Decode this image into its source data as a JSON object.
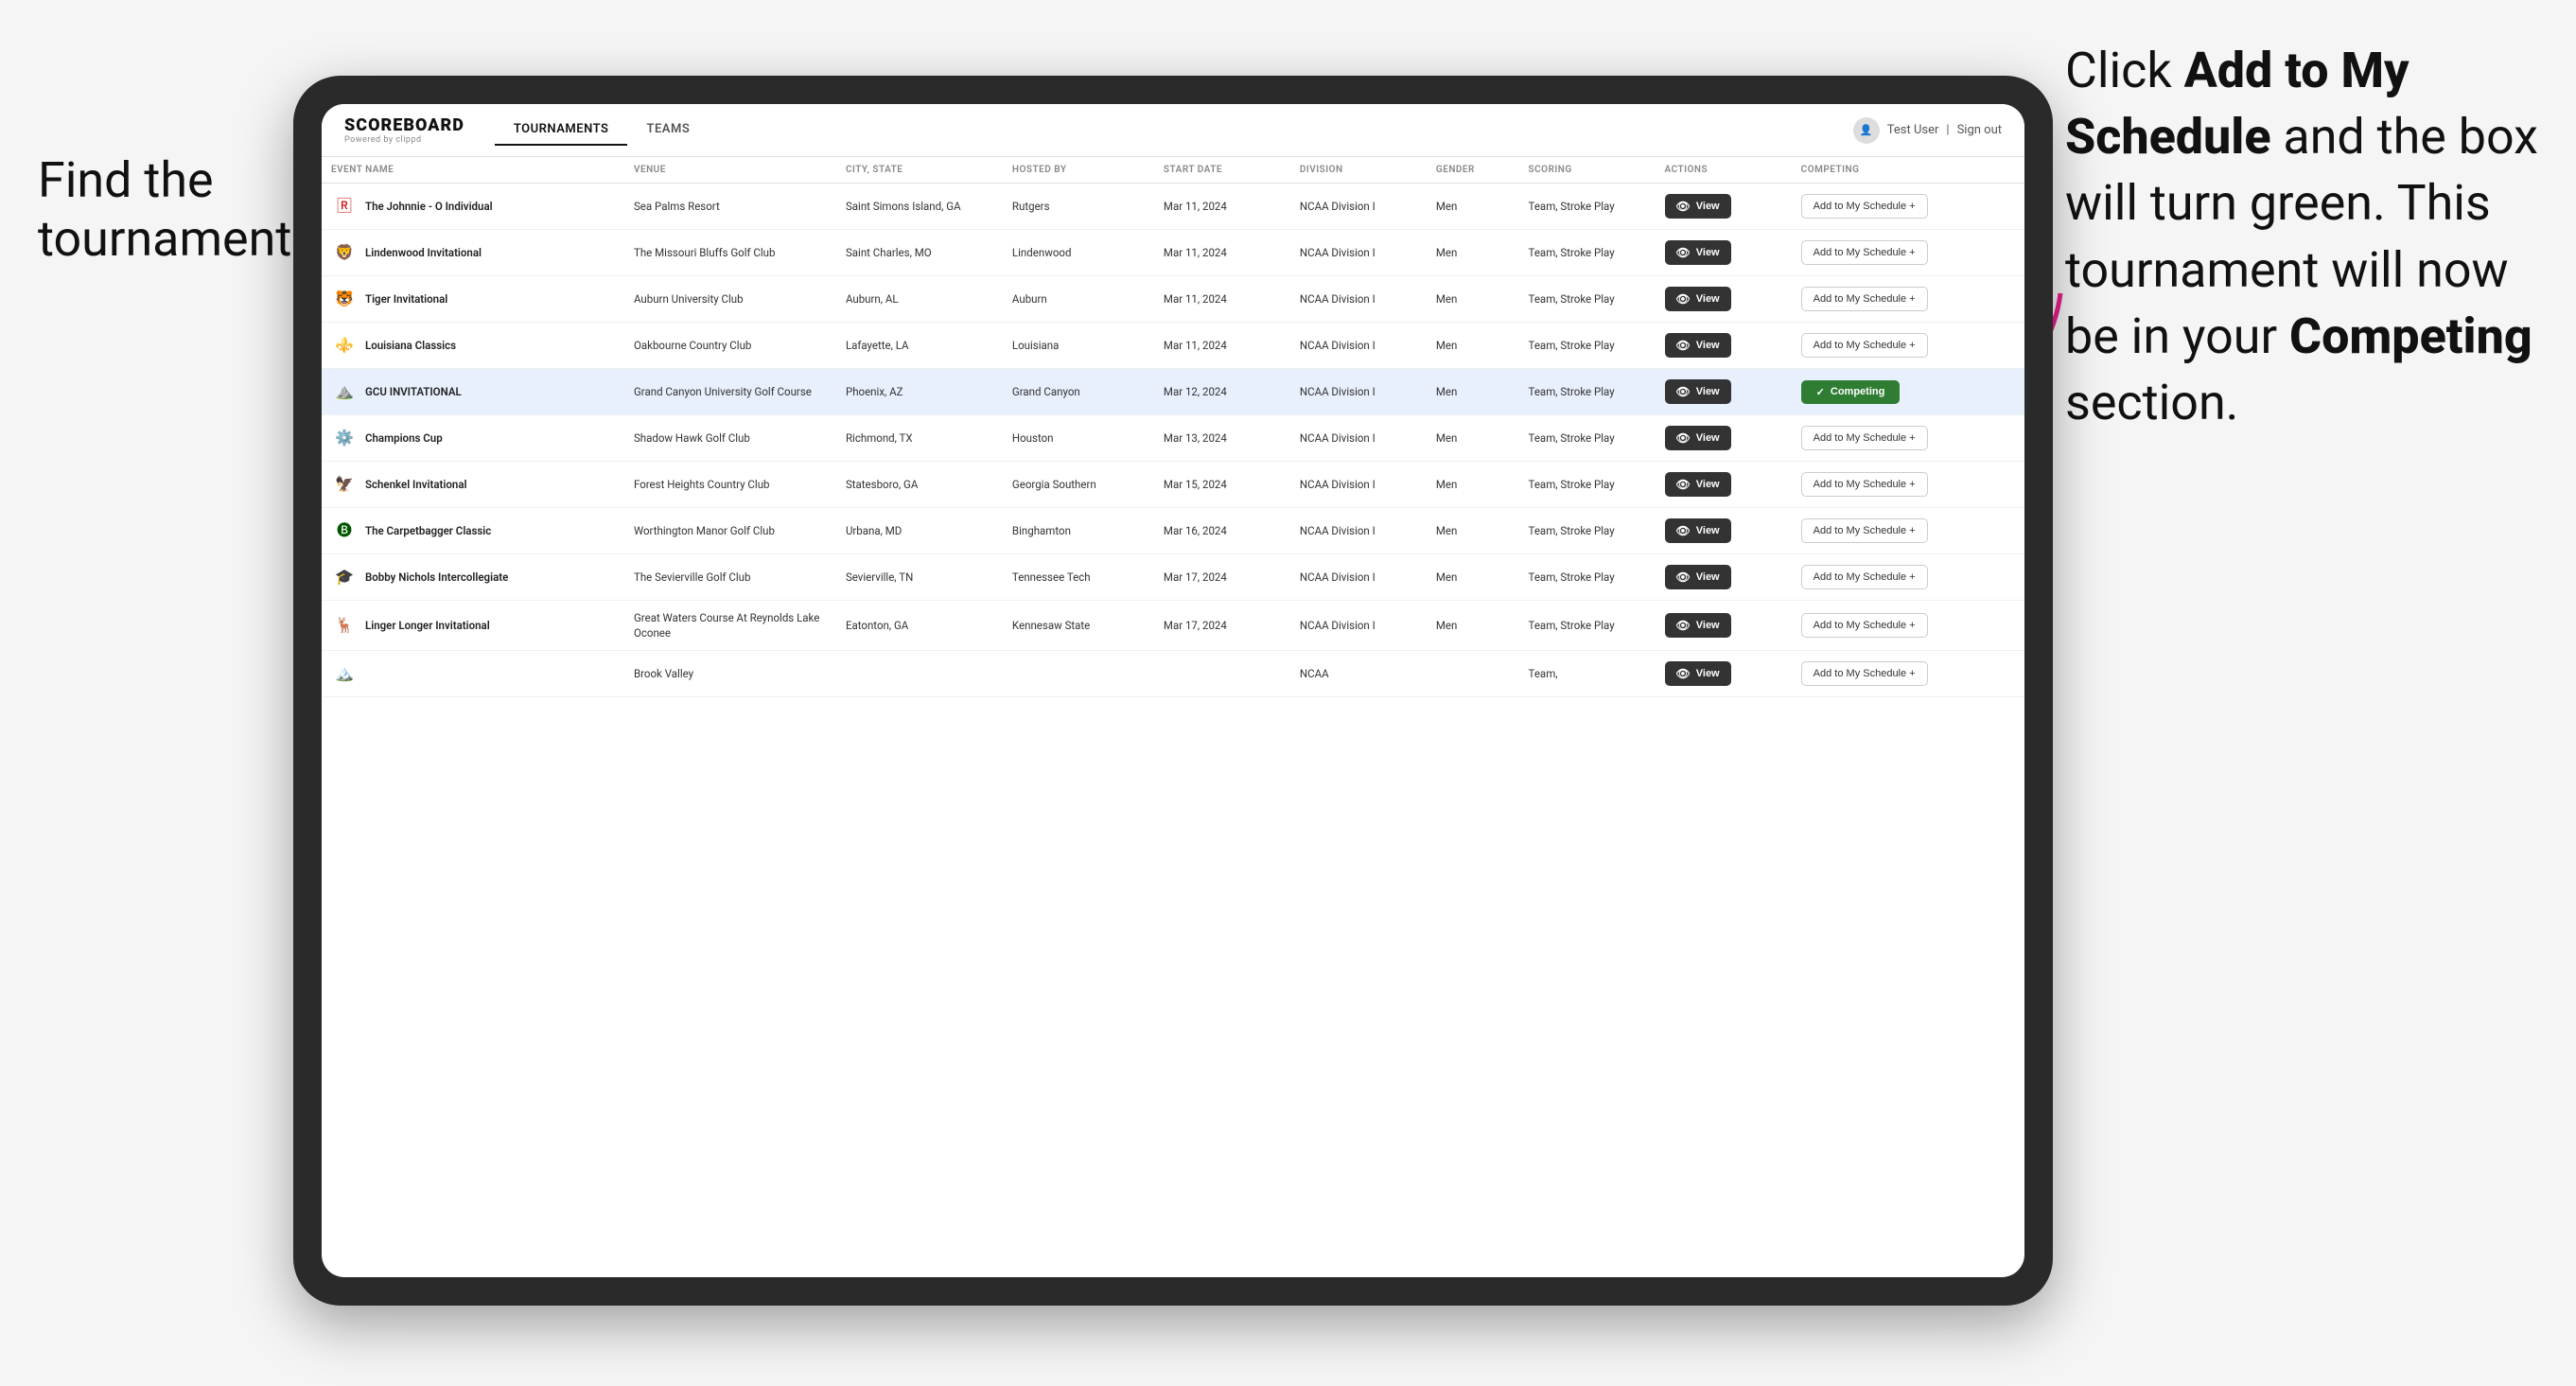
{
  "instructions": {
    "left": "Find the\ntournament.",
    "right_part1": "Click ",
    "right_bold1": "Add to My Schedule",
    "right_part2": " and the box will turn green. This tournament will now be in your ",
    "right_bold2": "Competing",
    "right_part3": " section."
  },
  "header": {
    "logo": "SCOREBOARD",
    "logo_sub": "Powered by clippd",
    "nav": [
      "TOURNAMENTS",
      "TEAMS"
    ],
    "active_nav": 0,
    "user": "Test User",
    "signout": "Sign out"
  },
  "table": {
    "columns": [
      "EVENT NAME",
      "VENUE",
      "CITY, STATE",
      "HOSTED BY",
      "START DATE",
      "DIVISION",
      "GENDER",
      "SCORING",
      "ACTIONS",
      "COMPETING"
    ],
    "rows": [
      {
        "logo": "🅁",
        "logo_color": "#cc0000",
        "event": "The Johnnie - O Individual",
        "venue": "Sea Palms Resort",
        "city": "Saint Simons Island, GA",
        "hosted": "Rutgers",
        "date": "Mar 11, 2024",
        "division": "NCAA Division I",
        "gender": "Men",
        "scoring": "Team, Stroke Play",
        "view_label": "View",
        "add_label": "Add to My Schedule +",
        "status": "add",
        "highlighted": false
      },
      {
        "logo": "🦁",
        "logo_color": "#003366",
        "event": "Lindenwood Invitational",
        "venue": "The Missouri Bluffs Golf Club",
        "city": "Saint Charles, MO",
        "hosted": "Lindenwood",
        "date": "Mar 11, 2024",
        "division": "NCAA Division I",
        "gender": "Men",
        "scoring": "Team, Stroke Play",
        "view_label": "View",
        "add_label": "Add to My Schedule +",
        "status": "add",
        "highlighted": false
      },
      {
        "logo": "🐯",
        "logo_color": "#f47321",
        "event": "Tiger Invitational",
        "venue": "Auburn University Club",
        "city": "Auburn, AL",
        "hosted": "Auburn",
        "date": "Mar 11, 2024",
        "division": "NCAA Division I",
        "gender": "Men",
        "scoring": "Team, Stroke Play",
        "view_label": "View",
        "add_label": "Add to My Schedule +",
        "status": "add",
        "highlighted": false
      },
      {
        "logo": "⚜️",
        "logo_color": "#7b0046",
        "event": "Louisiana Classics",
        "venue": "Oakbourne Country Club",
        "city": "Lafayette, LA",
        "hosted": "Louisiana",
        "date": "Mar 11, 2024",
        "division": "NCAA Division I",
        "gender": "Men",
        "scoring": "Team, Stroke Play",
        "view_label": "View",
        "add_label": "Add to My Schedule +",
        "status": "add",
        "highlighted": false
      },
      {
        "logo": "⛰️",
        "logo_color": "#522398",
        "event": "GCU INVITATIONAL",
        "venue": "Grand Canyon University Golf Course",
        "city": "Phoenix, AZ",
        "hosted": "Grand Canyon",
        "date": "Mar 12, 2024",
        "division": "NCAA Division I",
        "gender": "Men",
        "scoring": "Team, Stroke Play",
        "view_label": "View",
        "add_label": "Competing",
        "status": "competing",
        "highlighted": true
      },
      {
        "logo": "⚙️",
        "logo_color": "#cc0000",
        "event": "Champions Cup",
        "venue": "Shadow Hawk Golf Club",
        "city": "Richmond, TX",
        "hosted": "Houston",
        "date": "Mar 13, 2024",
        "division": "NCAA Division I",
        "gender": "Men",
        "scoring": "Team, Stroke Play",
        "view_label": "View",
        "add_label": "Add to My Schedule +",
        "status": "add",
        "highlighted": false
      },
      {
        "logo": "🦅",
        "logo_color": "#003366",
        "event": "Schenkel Invitational",
        "venue": "Forest Heights Country Club",
        "city": "Statesboro, GA",
        "hosted": "Georgia Southern",
        "date": "Mar 15, 2024",
        "division": "NCAA Division I",
        "gender": "Men",
        "scoring": "Team, Stroke Play",
        "view_label": "View",
        "add_label": "Add to My Schedule +",
        "status": "add",
        "highlighted": false
      },
      {
        "logo": "🅑",
        "logo_color": "#005500",
        "event": "The Carpetbagger Classic",
        "venue": "Worthington Manor Golf Club",
        "city": "Urbana, MD",
        "hosted": "Binghamton",
        "date": "Mar 16, 2024",
        "division": "NCAA Division I",
        "gender": "Men",
        "scoring": "Team, Stroke Play",
        "view_label": "View",
        "add_label": "Add to My Schedule +",
        "status": "add",
        "highlighted": false
      },
      {
        "logo": "🎓",
        "logo_color": "#aa4400",
        "event": "Bobby Nichols Intercollegiate",
        "venue": "The Sevierville Golf Club",
        "city": "Sevierville, TN",
        "hosted": "Tennessee Tech",
        "date": "Mar 17, 2024",
        "division": "NCAA Division I",
        "gender": "Men",
        "scoring": "Team, Stroke Play",
        "view_label": "View",
        "add_label": "Add to My Schedule +",
        "status": "add",
        "highlighted": false
      },
      {
        "logo": "🦌",
        "logo_color": "#cc6600",
        "event": "Linger Longer Invitational",
        "venue": "Great Waters Course At Reynolds Lake Oconee",
        "city": "Eatonton, GA",
        "hosted": "Kennesaw State",
        "date": "Mar 17, 2024",
        "division": "NCAA Division I",
        "gender": "Men",
        "scoring": "Team, Stroke Play",
        "view_label": "View",
        "add_label": "Add to My Schedule +",
        "status": "add",
        "highlighted": false
      },
      {
        "logo": "🏔️",
        "logo_color": "#003366",
        "event": "",
        "venue": "Brook Valley",
        "city": "",
        "hosted": "",
        "date": "",
        "division": "NCAA",
        "gender": "",
        "scoring": "Team,",
        "view_label": "View",
        "add_label": "Add to My Schedule +",
        "status": "add",
        "highlighted": false
      }
    ]
  }
}
